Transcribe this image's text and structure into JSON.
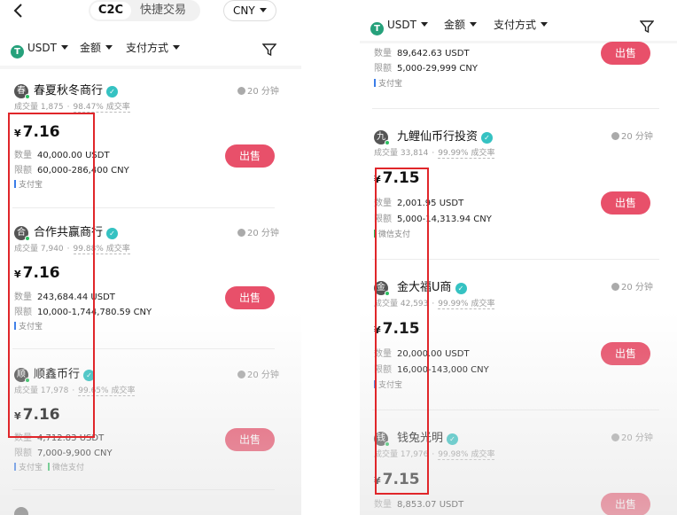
{
  "left": {
    "top_tabs": [
      "C2C",
      "快捷交易"
    ],
    "currency": "CNY",
    "filters": {
      "coin": "USDT",
      "amount": "金额",
      "payment": "支付方式"
    },
    "listings": [
      {
        "avatar": "春",
        "name": "春夏秋冬商行",
        "volume_label": "成交量",
        "volume": "1,875",
        "rate": "98.47% 成交率",
        "time": "20 分钟",
        "currency_symbol": "¥",
        "price": "7.16",
        "qty_label": "数量",
        "qty": "40,000.00 USDT",
        "limit_label": "限额",
        "limit": "60,000-286,400 CNY",
        "payments": [
          "支付宝"
        ],
        "action": "出售"
      },
      {
        "avatar": "合",
        "name": "合作共赢商行",
        "volume_label": "成交量",
        "volume": "7,940",
        "rate": "99.88% 成交率",
        "time": "20 分钟",
        "currency_symbol": "¥",
        "price": "7.16",
        "qty_label": "数量",
        "qty": "243,684.44 USDT",
        "limit_label": "限额",
        "limit": "10,000-1,744,780.59 CNY",
        "payments": [
          "支付宝"
        ],
        "action": "出售"
      },
      {
        "avatar": "顺",
        "name": "顺鑫币行",
        "volume_label": "成交量",
        "volume": "17,978",
        "rate": "99.65% 成交率",
        "time": "20 分钟",
        "currency_symbol": "¥",
        "price": "7.16",
        "qty_label": "数量",
        "qty": "4,712.83 USDT",
        "limit_label": "限额",
        "limit": "7,000-9,900 CNY",
        "payments": [
          "支付宝",
          "微信支付"
        ],
        "action": "出售"
      }
    ]
  },
  "right": {
    "filters": {
      "coin": "USDT",
      "amount": "金额",
      "payment": "支付方式"
    },
    "partial": {
      "qty_label": "数量",
      "qty": "89,642.63 USDT",
      "limit_label": "限额",
      "limit": "5,000-29,999 CNY",
      "payment": "支付宝",
      "action": "出售"
    },
    "listings": [
      {
        "avatar": "九",
        "name": "九鲤仙币行投资",
        "volume_label": "成交量",
        "volume": "33,814",
        "rate": "99.99% 成交率",
        "time": "20 分钟",
        "currency_symbol": "¥",
        "price": "7.15",
        "qty_label": "数量",
        "qty": "2,001.95 USDT",
        "limit_label": "限额",
        "limit": "5,000-14,313.94 CNY",
        "payments": [
          "微信支付"
        ],
        "action": "出售"
      },
      {
        "avatar": "金",
        "name": "金大福U商",
        "volume_label": "成交量",
        "volume": "42,593",
        "rate": "99.99% 成交率",
        "time": "20 分钟",
        "currency_symbol": "¥",
        "price": "7.15",
        "qty_label": "数量",
        "qty": "20,000.00 USDT",
        "limit_label": "限额",
        "limit": "16,000-143,000 CNY",
        "payments": [
          "支付宝"
        ],
        "action": "出售"
      },
      {
        "avatar": "钱",
        "name": "钱兔光明",
        "volume_label": "成交量",
        "volume": "17,976",
        "rate": "99.98% 成交率",
        "time": "20 分钟",
        "currency_symbol": "¥",
        "price": "7.15",
        "qty_label": "数量",
        "qty": "8,853.07 USDT",
        "action": "出售"
      }
    ]
  },
  "colors": {
    "sell_button": "#e8506a",
    "highlight_box": "#e0262a",
    "tether": "#26a17b",
    "verified": "#35c2c2"
  }
}
